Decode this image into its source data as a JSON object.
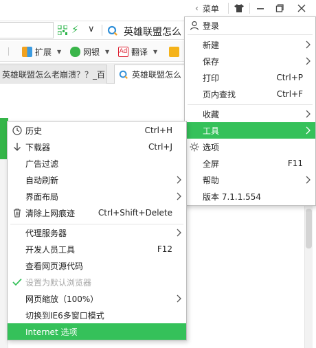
{
  "titlebar": {
    "menu_label": "菜单"
  },
  "addressbar": {
    "search_text": "英雄联盟怎么"
  },
  "extbar": {
    "extensions": "扩展",
    "netbank": "网银",
    "translate": "翻译",
    "translate_icon": "Ad"
  },
  "tabs": {
    "inactive": "英雄联盟怎么老崩溃？？_百",
    "active": "英雄联盟怎么"
  },
  "main_menu": {
    "login": "登录",
    "new": "新建",
    "save": "保存",
    "print": "打印",
    "print_sc": "Ctrl+P",
    "find": "页内查找",
    "find_sc": "Ctrl+F",
    "favorites": "收藏",
    "tools": "工具",
    "options": "选项",
    "fullscreen": "全屏",
    "fullscreen_sc": "F11",
    "help": "帮助",
    "version": "版本 7.1.1.554"
  },
  "tools_menu": {
    "history": "历史",
    "history_sc": "Ctrl+H",
    "downloader": "下载器",
    "downloader_sc": "Ctrl+J",
    "adfilter": "广告过滤",
    "autorefresh": "自动刷新",
    "layout": "界面布局",
    "clear_traces": "清除上网痕迹",
    "clear_traces_sc": "Ctrl+Shift+Delete",
    "proxy": "代理服务器",
    "devtools": "开发人员工具",
    "devtools_sc": "F12",
    "view_source": "查看网页源代码",
    "set_default": "设置为默认浏览器",
    "zoom": "网页缩放（100%）",
    "ie6_mode": "切换到IE6多窗口模式",
    "internet_options": "Internet 选项"
  },
  "colors": {
    "highlight": "#35c15a",
    "accent_green": "#2cb44a"
  }
}
